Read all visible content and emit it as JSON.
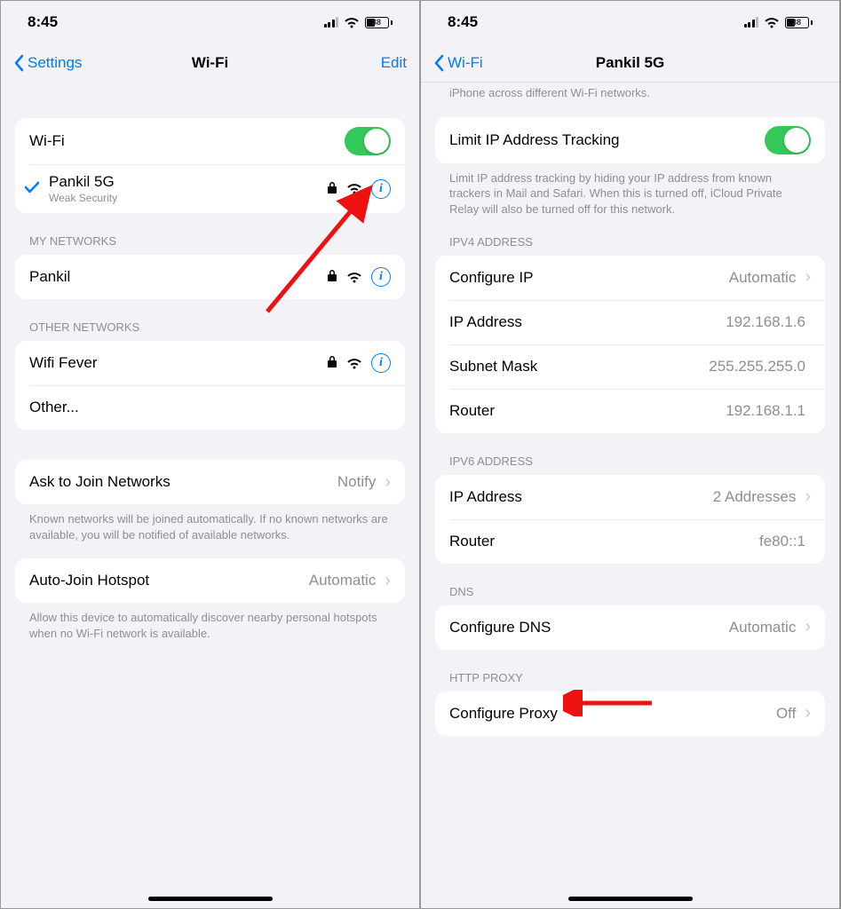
{
  "status": {
    "time": "8:45",
    "battery": "38"
  },
  "left": {
    "nav": {
      "back": "Settings",
      "title": "Wi-Fi",
      "edit": "Edit"
    },
    "wifi_label": "Wi-Fi",
    "connected": {
      "name": "Pankil 5G",
      "note": "Weak Security"
    },
    "my_networks_header": "MY NETWORKS",
    "my_networks": [
      {
        "name": "Pankil"
      }
    ],
    "other_networks_header": "OTHER NETWORKS",
    "other_networks": [
      {
        "name": "Wifi Fever"
      }
    ],
    "other_label": "Other...",
    "ask_join": {
      "label": "Ask to Join Networks",
      "value": "Notify",
      "footer": "Known networks will be joined automatically. If no known networks are available, you will be notified of available networks."
    },
    "auto_hotspot": {
      "label": "Auto-Join Hotspot",
      "value": "Automatic",
      "footer": "Allow this device to automatically discover nearby personal hotspots when no Wi-Fi network is available."
    }
  },
  "right": {
    "nav": {
      "back": "Wi-Fi",
      "title": "Pankil 5G"
    },
    "top_footer": "iPhone across different Wi-Fi networks.",
    "limit_ip": {
      "label": "Limit IP Address Tracking",
      "footer": "Limit IP address tracking by hiding your IP address from known trackers in Mail and Safari. When this is turned off, iCloud Private Relay will also be turned off for this network."
    },
    "ipv4_header": "IPV4 ADDRESS",
    "ipv4": {
      "configure": {
        "label": "Configure IP",
        "value": "Automatic"
      },
      "ip": {
        "label": "IP Address",
        "value": "192.168.1.6"
      },
      "subnet": {
        "label": "Subnet Mask",
        "value": "255.255.255.0"
      },
      "router": {
        "label": "Router",
        "value": "192.168.1.1"
      }
    },
    "ipv6_header": "IPV6 ADDRESS",
    "ipv6": {
      "ip": {
        "label": "IP Address",
        "value": "2 Addresses"
      },
      "router": {
        "label": "Router",
        "value": "fe80::1"
      }
    },
    "dns_header": "DNS",
    "dns": {
      "label": "Configure DNS",
      "value": "Automatic"
    },
    "proxy_header": "HTTP PROXY",
    "proxy": {
      "label": "Configure Proxy",
      "value": "Off"
    }
  }
}
